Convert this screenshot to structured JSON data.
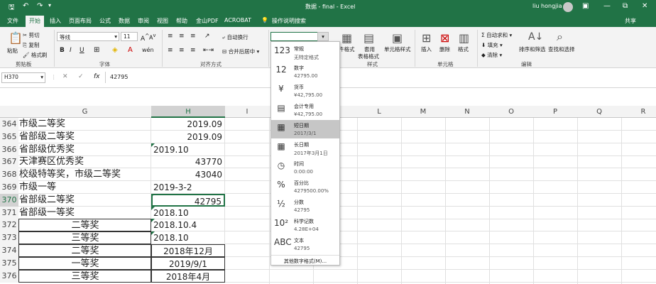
{
  "titlebar": {
    "title": "数据 - final - Excel",
    "user": "liu hongjia",
    "quick": [
      "save-icon",
      "undo-icon",
      "redo-icon"
    ],
    "win": [
      "—",
      "⧉",
      "✕"
    ]
  },
  "tabs": [
    "文件",
    "开始",
    "插入",
    "页面布局",
    "公式",
    "数据",
    "审阅",
    "视图",
    "帮助",
    "金山PDF",
    "ACROBAT",
    "操作说明搜索"
  ],
  "share": "共享",
  "ribbon": {
    "paste": "粘贴",
    "cut": "剪切",
    "copy": "复制",
    "painter": "格式刷",
    "clipboard": "剪贴板",
    "font_name": "等线",
    "font_size": "11",
    "font_group": "字体",
    "wrap": "自动换行",
    "merge": "合并后居中",
    "align_group": "对齐方式",
    "numfmt": "",
    "cond": "件格式",
    "table": "套用",
    "table2": "表格格式",
    "cellstyle": "单元格样式",
    "style_group": "样式",
    "insert": "插入",
    "delete": "删除",
    "format": "格式",
    "cells_group": "单元格",
    "autosum": "自动求和",
    "fill": "填充",
    "clear": "清除",
    "sort": "排序和筛选",
    "find": "查找和选择",
    "edit_group": "编辑"
  },
  "formula": {
    "namebox": "H370",
    "value": "42795",
    "fx": "fx"
  },
  "columns": [
    {
      "l": "G"
    },
    {
      "l": "H"
    },
    {
      "l": "I"
    },
    {
      "l": "J"
    },
    {
      "l": "K"
    },
    {
      "l": "L"
    },
    {
      "l": "M"
    },
    {
      "l": "N"
    },
    {
      "l": "O"
    },
    {
      "l": "P"
    },
    {
      "l": "Q"
    },
    {
      "l": "R"
    }
  ],
  "rows": [
    {
      "n": "364",
      "g": "市级二等奖",
      "h": "2019.09",
      "ga": "left",
      "ha": "right",
      "tri": false
    },
    {
      "n": "365",
      "g": "省部级二等奖",
      "h": "2019.09",
      "ga": "left",
      "ha": "right",
      "tri": false
    },
    {
      "n": "366",
      "g": "省部级优秀奖",
      "h": "2019.10",
      "ga": "left",
      "ha": "left",
      "tri": true
    },
    {
      "n": "367",
      "g": "天津赛区优秀奖",
      "h": "43770",
      "ga": "left",
      "ha": "right",
      "tri": false
    },
    {
      "n": "368",
      "g": "校级特等奖，市级二等奖",
      "h": "43040",
      "ga": "left",
      "ha": "right",
      "tri": false
    },
    {
      "n": "369",
      "g": "市级一等",
      "h": "2019-3-2",
      "ga": "left",
      "ha": "left",
      "tri": false
    },
    {
      "n": "370",
      "g": "省部级二等奖",
      "h": "42795",
      "ga": "left",
      "ha": "right",
      "tri": true,
      "active": true
    },
    {
      "n": "371",
      "g": "省部级一等奖",
      "h": "2018.10",
      "ga": "left",
      "ha": "left",
      "tri": true
    },
    {
      "n": "372",
      "g": "二等奖",
      "h": "2018.10.4",
      "ga": "center",
      "ha": "left",
      "tri": true
    },
    {
      "n": "373",
      "g": "三等奖",
      "h": "2018.10",
      "ga": "center",
      "ha": "left",
      "tri": true
    },
    {
      "n": "374",
      "g": "二等奖",
      "h": "2018年12月",
      "ga": "center",
      "ha": "center",
      "tri": false
    },
    {
      "n": "375",
      "g": "一等奖",
      "h": "2019/9/1",
      "ga": "center",
      "ha": "center",
      "tri": false
    },
    {
      "n": "376",
      "g": "三等奖",
      "h": "2018年4月",
      "ga": "center",
      "ha": "center",
      "tri": false
    }
  ],
  "dropdown": {
    "items": [
      {
        "icon": "123",
        "name": "常规",
        "ex": "无特定格式"
      },
      {
        "icon": "12",
        "name": "数字",
        "ex": "42795.00"
      },
      {
        "icon": "¥",
        "name": "货币",
        "ex": "¥42,795.00"
      },
      {
        "icon": "▤",
        "name": "会计专用",
        "ex": "¥42,795.00"
      },
      {
        "icon": "▦",
        "name": "短日期",
        "ex": "2017/3/1",
        "sel": true
      },
      {
        "icon": "▦",
        "name": "长日期",
        "ex": "2017年3月1日"
      },
      {
        "icon": "◷",
        "name": "时间",
        "ex": "0:00:00"
      },
      {
        "icon": "%",
        "name": "百分比",
        "ex": "4279500.00%"
      },
      {
        "icon": "½",
        "name": "分数",
        "ex": "42795"
      },
      {
        "icon": "10²",
        "name": "科学记数",
        "ex": "4.28E+04"
      },
      {
        "icon": "ABC",
        "name": "文本",
        "ex": "42795"
      }
    ],
    "more": "其他数字格式(M)..."
  }
}
